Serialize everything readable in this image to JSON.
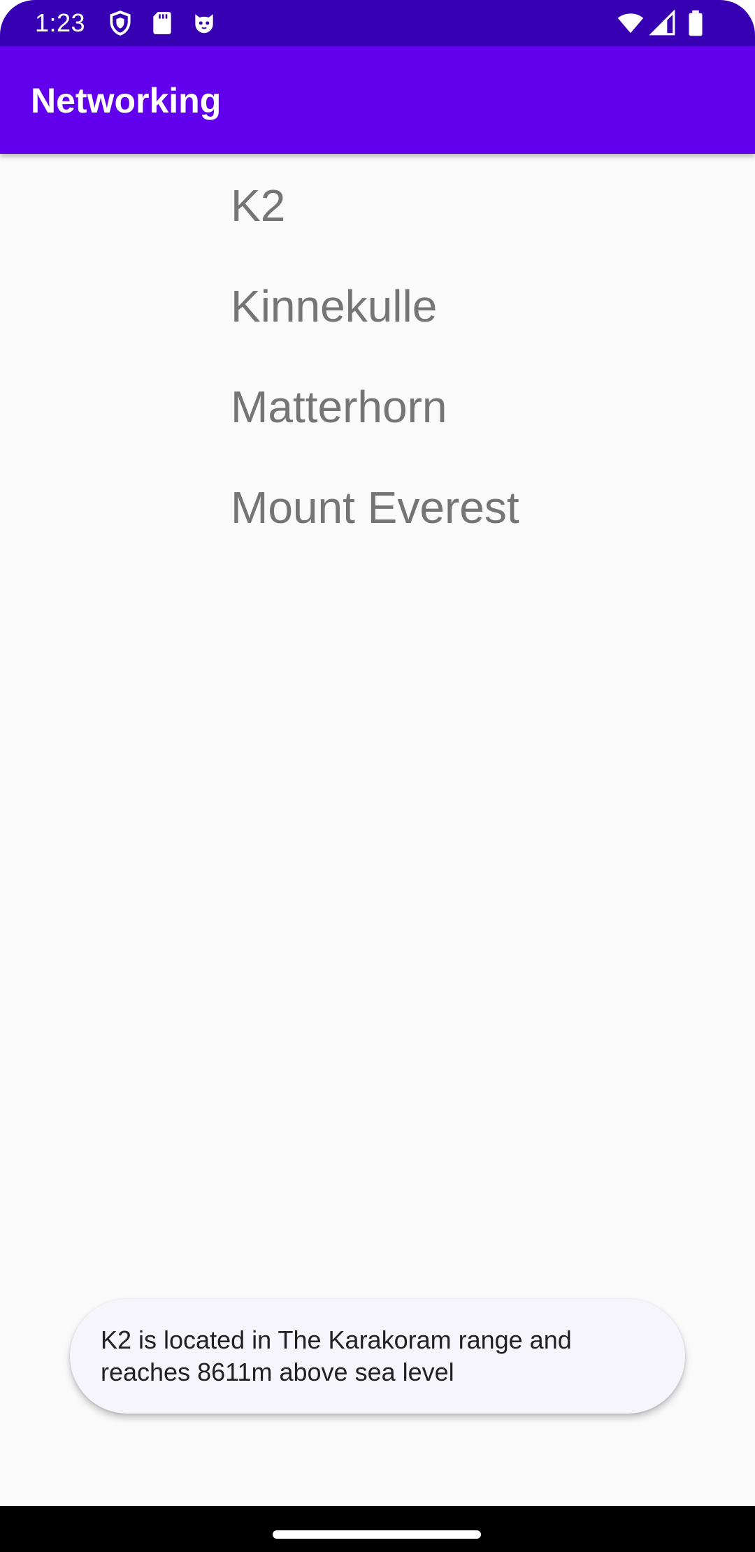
{
  "status_bar": {
    "time": "1:23",
    "icons": [
      "shield-icon",
      "sd-card-icon",
      "cat-face-icon",
      "wifi-icon",
      "signal-icon",
      "battery-icon"
    ]
  },
  "app_bar": {
    "title": "Networking"
  },
  "mountains": [
    {
      "name": "K2"
    },
    {
      "name": "Kinnekulle"
    },
    {
      "name": "Matterhorn"
    },
    {
      "name": "Mount Everest"
    }
  ],
  "toast": {
    "message": "K2 is located in The Karakoram range and reaches 8611m above sea level"
  },
  "colors": {
    "status_bar": "#3700b3",
    "app_bar": "#6200ee",
    "list_text": "#757575",
    "background": "#fafafa"
  }
}
